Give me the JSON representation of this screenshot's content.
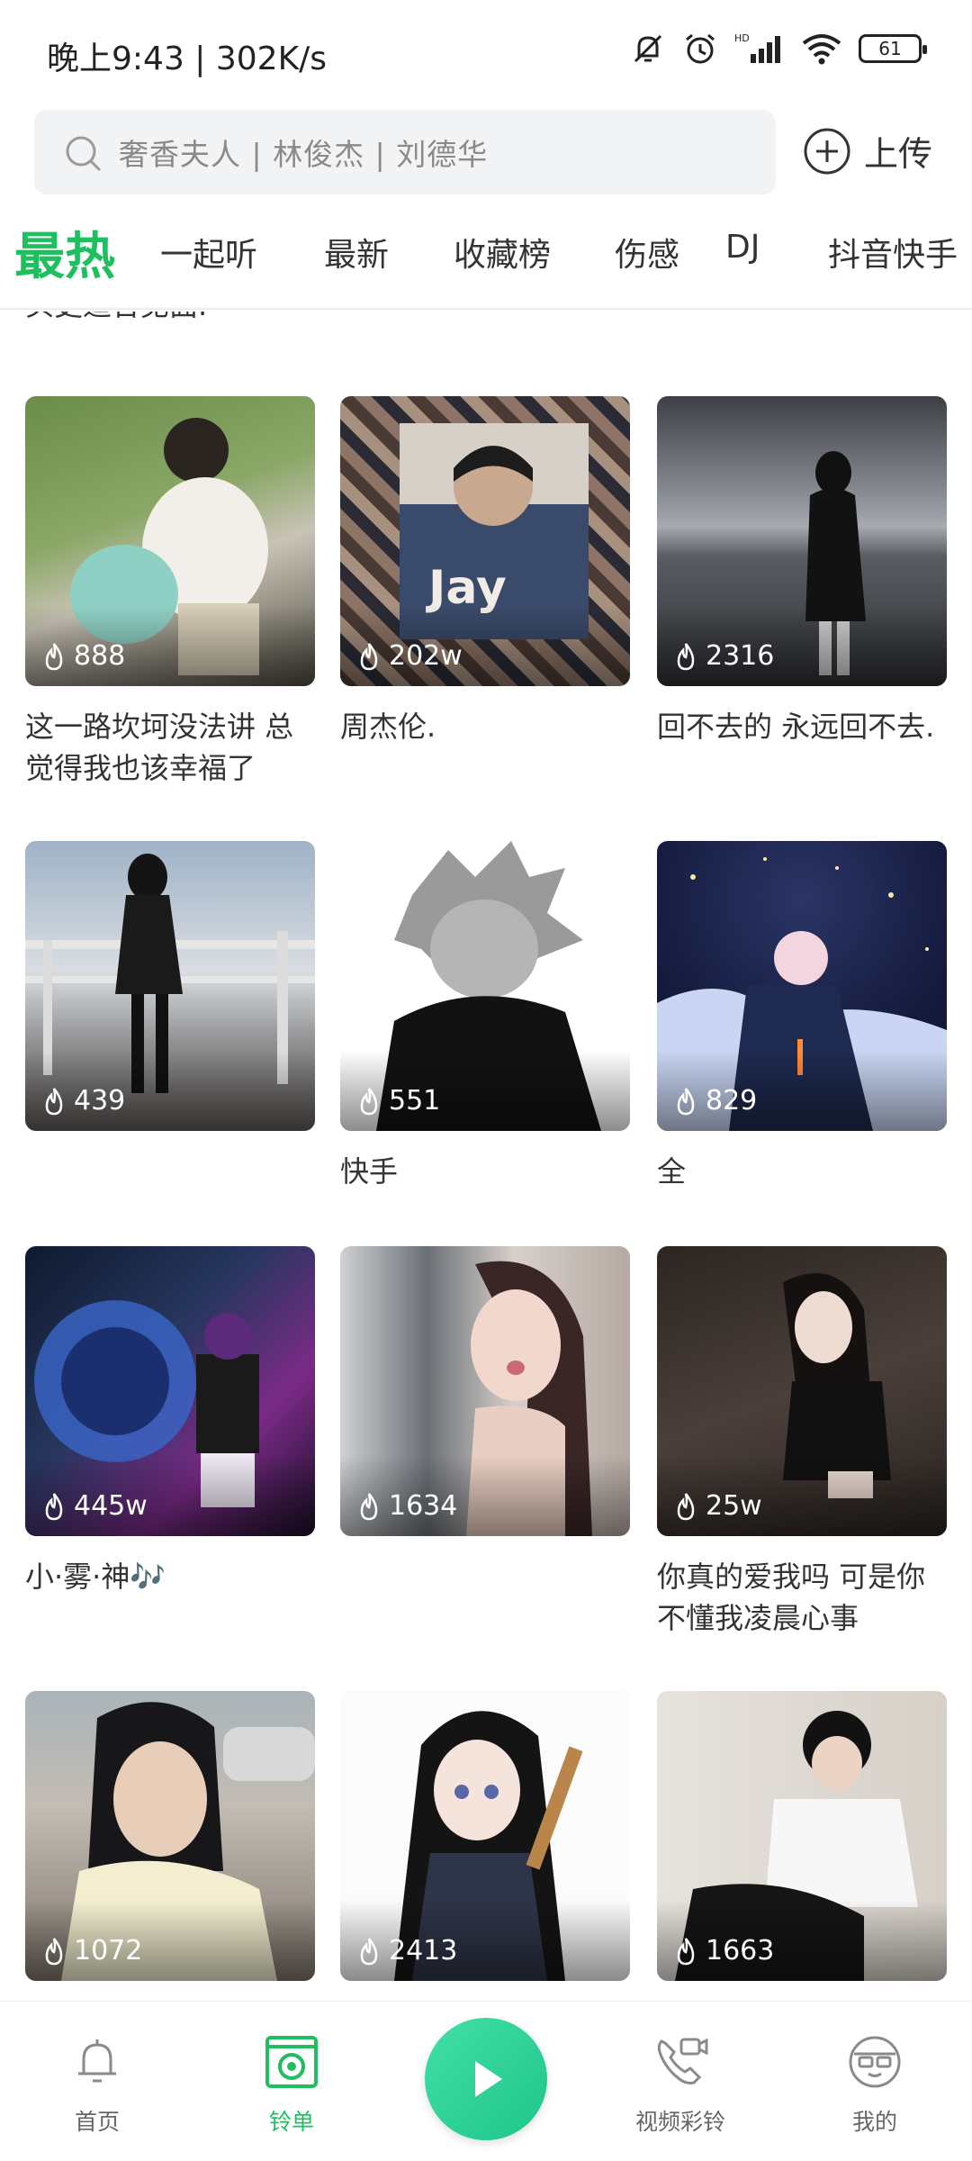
{
  "status_bar": {
    "time": "晚上9:43 | 302K/s",
    "battery": "61",
    "icons": [
      "mute-bell-icon",
      "alarm-icon",
      "hd-signal-icon",
      "wifi-icon",
      "battery-icon"
    ]
  },
  "search": {
    "placeholder": "奢香夫人 | 林俊杰 | 刘德华",
    "upload_label": "上传"
  },
  "tabs": [
    {
      "label": "最热",
      "active": true
    },
    {
      "label": "一起听"
    },
    {
      "label": "最新"
    },
    {
      "label": "收藏榜"
    },
    {
      "label": "伤感"
    },
    {
      "label": "DJ"
    },
    {
      "label": "抖音快手"
    }
  ],
  "peek_text": "头更适合见面.",
  "cards": [
    {
      "count": "888",
      "title": "这一路坎坷没法讲 总觉得我也该幸福了"
    },
    {
      "count": "202w",
      "title": "周杰伦."
    },
    {
      "count": "2316",
      "title": "回不去的 永远回不去."
    },
    {
      "count": "439",
      "title": ""
    },
    {
      "count": "551",
      "title": "快手"
    },
    {
      "count": "829",
      "title": "全"
    },
    {
      "count": "445w",
      "title": "小·雾·神🎶"
    },
    {
      "count": "1634",
      "title": ""
    },
    {
      "count": "25w",
      "title": "你真的爱我吗  可是你不懂我凌晨心事"
    },
    {
      "count": "1072",
      "title": ""
    },
    {
      "count": "2413",
      "title": ""
    },
    {
      "count": "1663",
      "title": ""
    }
  ],
  "nav": {
    "home": "首页",
    "playlist": "铃单",
    "video_ringtone": "视频彩铃",
    "mine": "我的"
  },
  "colors": {
    "accent": "#1fbe5f",
    "fab": "#2fd29a"
  }
}
